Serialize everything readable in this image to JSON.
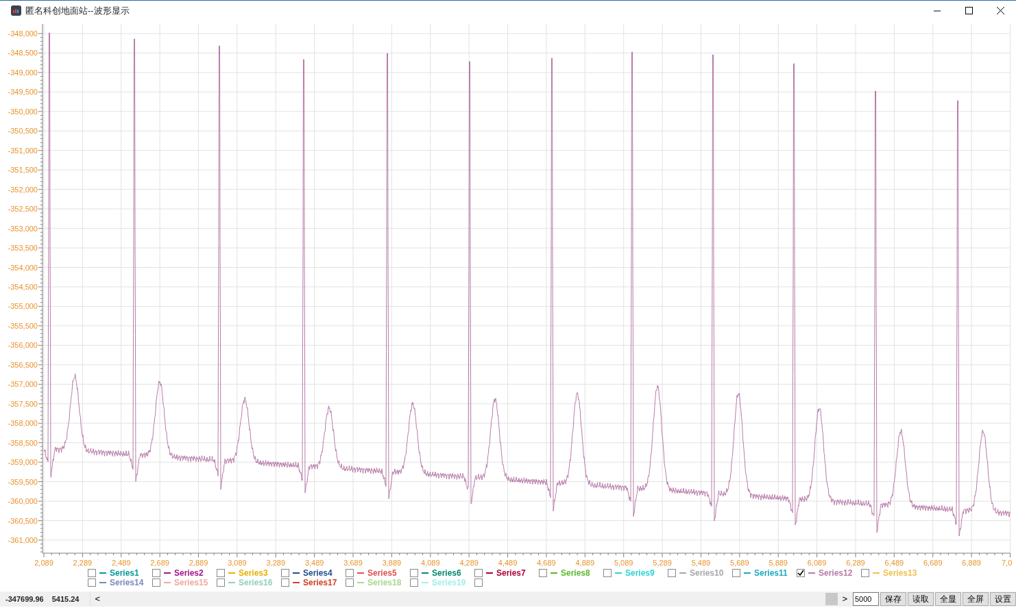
{
  "window": {
    "title": "匿名科创地面站--波形显示"
  },
  "chart": {
    "y_ticks": [
      "-348,000",
      "-348,500",
      "-349,000",
      "-349,500",
      "-350,000",
      "-350,500",
      "-351,000",
      "-351,500",
      "-352,000",
      "-352,500",
      "-353,000",
      "-353,500",
      "-354,000",
      "-354,500",
      "-355,000",
      "-355,500",
      "-356,000",
      "-356,500",
      "-357,000",
      "-357,500",
      "-358,000",
      "-358,500",
      "-359,000",
      "-359,500",
      "-360,000",
      "-360,500",
      "-361,000"
    ],
    "x_ticks": [
      "2,089",
      "2,289",
      "2,489",
      "2,689",
      "2,889",
      "3,089",
      "3,289",
      "3,489",
      "3,689",
      "3,889",
      "4,089",
      "4,289",
      "4,489",
      "4,689",
      "4,889",
      "5,089",
      "5,289",
      "5,489",
      "5,689",
      "5,889",
      "6,089",
      "6,289",
      "6,489",
      "6,689",
      "6,889",
      "7,0"
    ]
  },
  "legend_rows": [
    [
      {
        "name": "Series1",
        "color": "#009999",
        "checked": false
      },
      {
        "name": "Series2",
        "color": "#a0148c",
        "checked": false
      },
      {
        "name": "Series3",
        "color": "#e8b000",
        "checked": false
      },
      {
        "name": "Series4",
        "color": "#1f4e8c",
        "checked": false
      },
      {
        "name": "Series5",
        "color": "#e05050",
        "checked": false
      },
      {
        "name": "Series6",
        "color": "#00896b",
        "checked": false
      },
      {
        "name": "Series7",
        "color": "#b0003a",
        "checked": false
      },
      {
        "name": "Series8",
        "color": "#5cb82c",
        "checked": false
      },
      {
        "name": "Series9",
        "color": "#2dd4d4",
        "checked": false
      },
      {
        "name": "Series10",
        "color": "#a8a8a8",
        "checked": false
      },
      {
        "name": "Series11",
        "color": "#19aabb",
        "checked": false
      },
      {
        "name": "Series12",
        "color": "#b87aa8",
        "checked": true
      },
      {
        "name": "Series13",
        "color": "#f0c050",
        "checked": false
      }
    ],
    [
      {
        "name": "Series14",
        "color": "#7a88c0",
        "checked": false
      },
      {
        "name": "Series15",
        "color": "#f0a8a0",
        "checked": false
      },
      {
        "name": "Series16",
        "color": "#90d0b8",
        "checked": false
      },
      {
        "name": "Series17",
        "color": "#d04020",
        "checked": false
      },
      {
        "name": "Series18",
        "color": "#a8d890",
        "checked": false
      },
      {
        "name": "Series19",
        "color": "#a0f0f0",
        "checked": false
      },
      {
        "checked": false
      }
    ]
  ],
  "status": {
    "value_1": "-347699.96",
    "value_2": "5415.24"
  },
  "scrollbar": {
    "left_arrow": "<",
    "right_arrow": ">"
  },
  "count_field": {
    "value": "5000"
  },
  "buttons": [
    "保存",
    "读取",
    "全显",
    "全屏",
    "设置"
  ]
}
